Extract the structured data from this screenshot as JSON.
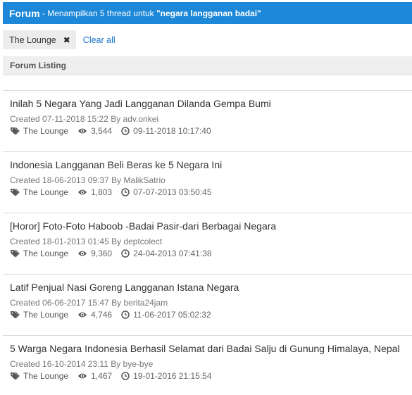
{
  "header": {
    "title": "Forum",
    "prefix": " - Menampilkan 5 thread untuk ",
    "query": "\"negara langganan badai\""
  },
  "filters": {
    "chip_label": "The Lounge",
    "clear_label": "Clear all"
  },
  "listing": {
    "title": "Forum Listing"
  },
  "threads": [
    {
      "title": "Inilah 5 Negara Yang Jadi Langganan Dilanda Gempa Bumi",
      "created": "Created 07-11-2018 15:22 By adv.onkei",
      "forum": "The Lounge",
      "views": "3,544",
      "last": "09-11-2018 10:17:40"
    },
    {
      "title": "Indonesia Langganan Beli Beras ke 5 Negara Ini",
      "created": "Created 18-06-2013 09:37 By MalikSatrio",
      "forum": "The Lounge",
      "views": "1,803",
      "last": "07-07-2013 03:50:45"
    },
    {
      "title": "[Horor] Foto-Foto Haboob -Badai Pasir-dari Berbagai Negara",
      "created": "Created 18-01-2013 01:45 By deptcolect",
      "forum": "The Lounge",
      "views": "9,360",
      "last": "24-04-2013 07:41:38"
    },
    {
      "title": "Latif Penjual Nasi Goreng Langganan Istana Negara",
      "created": "Created 06-06-2017 15:47 By berita24jam",
      "forum": "The Lounge",
      "views": "4,746",
      "last": "11-06-2017 05:02:32"
    },
    {
      "title": "5 Warga Negara Indonesia Berhasil Selamat dari Badai Salju di Gunung Himalaya, Nepal",
      "created": "Created 16-10-2014 23:11 By bye-bye",
      "forum": "The Lounge",
      "views": "1,467",
      "last": "19-01-2016 21:15:54"
    }
  ],
  "icons": {
    "tag": "tag-icon",
    "views": "eye-icon",
    "last": "clock-icon",
    "remove": "close-icon"
  },
  "colors": {
    "header_bg": "#1d88d8",
    "link": "#1a73c8"
  }
}
